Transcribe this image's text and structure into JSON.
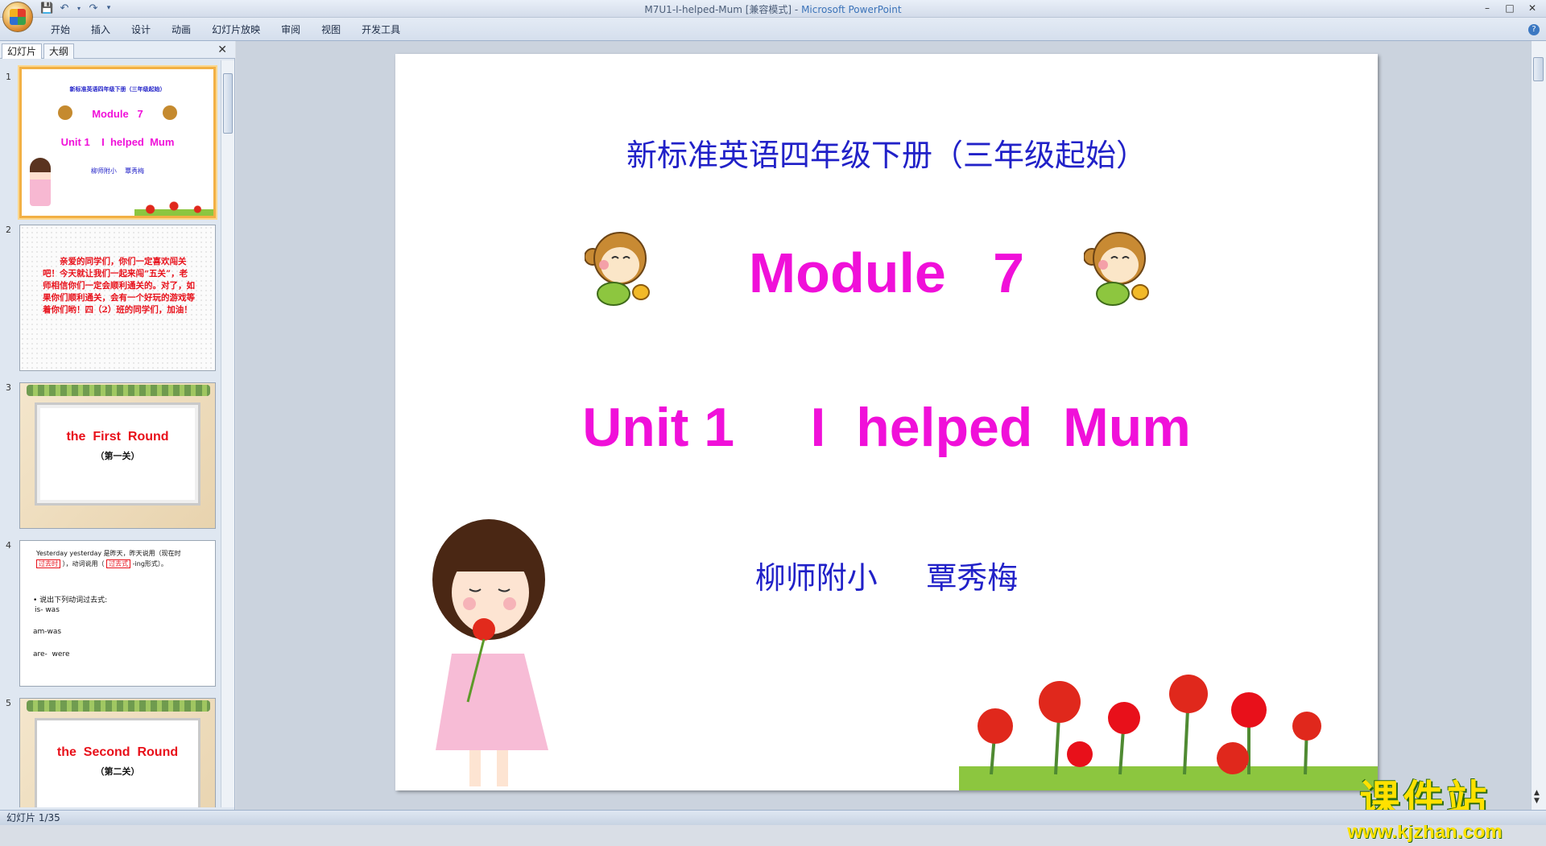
{
  "window": {
    "title": "M7U1-I-helped-Mum [兼容模式]",
    "app_name": "Microsoft PowerPoint"
  },
  "ribbon": {
    "tabs": [
      "开始",
      "插入",
      "设计",
      "动画",
      "幻灯片放映",
      "审阅",
      "视图",
      "开发工具"
    ]
  },
  "panel": {
    "tab_slides": "幻灯片",
    "tab_outline": "大纲",
    "close_label": "✕"
  },
  "thumbnails": [
    {
      "num": "1",
      "title": "新标准英语四年级下册（三年级起始）",
      "module": "Module   7",
      "unit": "Unit 1    I  helped  Mum",
      "author": "柳师附小    覃秀梅"
    },
    {
      "num": "2",
      "text": "亲爱的同学们，你们一定喜欢闯关吧！今天就让我们一起来闯“五关”，老师相信你们一定会顺利通关的。对了，如果你们顺利通关，会有一个好玩的游戏等着你们哟！四（2）班的同学们，加油！"
    },
    {
      "num": "3",
      "title": "the  First  Round",
      "sub": "（第一关）"
    },
    {
      "num": "4",
      "line1": "Yesterday yesterday 是昨天，昨天说用（现在时",
      "box1": "过去时",
      "line2": "），动词说用（",
      "box2": "过去式",
      "line3": "-ing形式）。",
      "bullet": "• 说出下列动词过去式:",
      "rows": [
        {
          "v": "is-",
          "p": "was"
        },
        {
          "v": "am-",
          "p": "was"
        },
        {
          "v": "are-",
          "p": "were"
        }
      ]
    },
    {
      "num": "5",
      "title": "the  Second  Round",
      "sub": "（第二关）"
    }
  ],
  "slide": {
    "subtitle": "新标准英语四年级下册（三年级起始）",
    "module": "Module   7",
    "unit": "Unit 1     I  helped  Mum",
    "author": "柳师附小     覃秀梅"
  },
  "watermark": {
    "big": "课件站",
    "url": "www.kjzhan.com"
  },
  "status": {
    "text": "幻灯片 1/35"
  },
  "colors": {
    "magenta": "#f010d9",
    "blue": "#2121c8",
    "thumb_red": "#e8101a"
  }
}
